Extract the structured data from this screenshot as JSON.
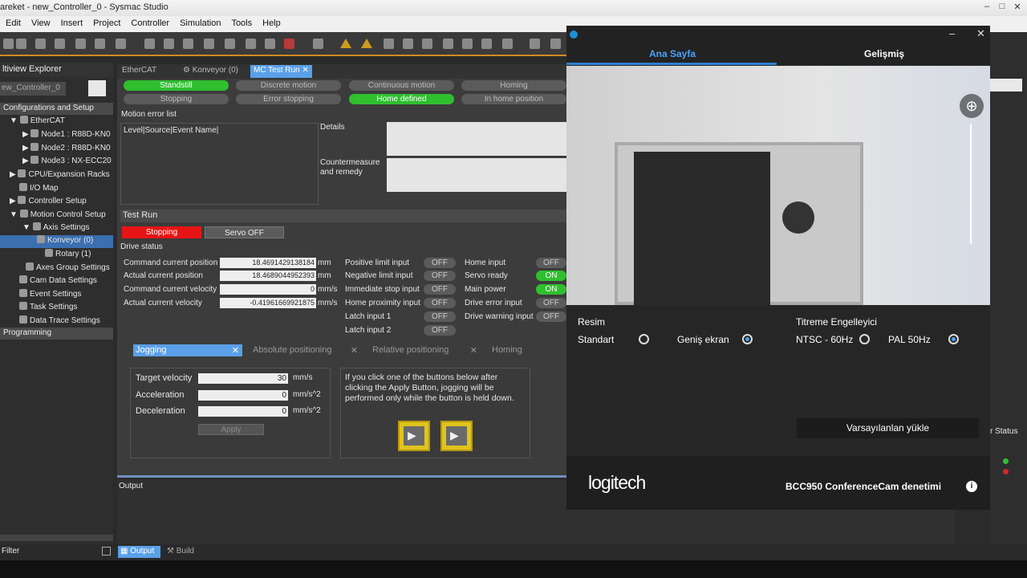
{
  "window": {
    "title": "areket - new_Controller_0 - Sysmac Studio"
  },
  "menu": [
    "Edit",
    "View",
    "Insert",
    "Project",
    "Controller",
    "Simulation",
    "Tools",
    "Help"
  ],
  "explorer": {
    "header": "ltiview Explorer",
    "controller": "ew_Controller_0",
    "section_config": "Configurations and Setup",
    "items": [
      {
        "label": "EtherCAT",
        "icon": "ethercat-icon"
      },
      {
        "label": "Node1 : R88D-KN0",
        "icon": "node-icon"
      },
      {
        "label": "Node2 : R88D-KN0",
        "icon": "node-icon"
      },
      {
        "label": "Node3 : NX-ECC20",
        "icon": "node-icon"
      },
      {
        "label": "CPU/Expansion Racks",
        "icon": "rack-icon"
      },
      {
        "label": "I/O Map",
        "icon": "io-map-icon"
      },
      {
        "label": "Controller Setup",
        "icon": "controller-setup-icon"
      },
      {
        "label": "Motion Control Setup",
        "icon": "motion-icon"
      },
      {
        "label": "Axis Settings",
        "icon": "axis-icon"
      },
      {
        "label": "Konveyor (0)",
        "icon": "axis-icon"
      },
      {
        "label": "Rotary (1)",
        "icon": "axis-icon"
      },
      {
        "label": "Axes Group Settings",
        "icon": "axes-group-icon"
      },
      {
        "label": "Cam Data Settings",
        "icon": "cam-icon"
      },
      {
        "label": "Event Settings",
        "icon": "event-icon"
      },
      {
        "label": "Task Settings",
        "icon": "task-icon"
      },
      {
        "label": "Data Trace Settings",
        "icon": "trace-icon"
      }
    ],
    "section_programming": "Programming",
    "filter": "Filter"
  },
  "editor": {
    "tabs": [
      "EtherCAT",
      "Konveyor (0)",
      "MC Test Run"
    ],
    "status_row1": [
      "Standstill",
      "Discrete motion",
      "Continuous motion",
      "Homing"
    ],
    "status_row2": [
      "Stopping",
      "Error stopping",
      "Home defined",
      "In home position"
    ],
    "motion_error_list": "Motion error list",
    "error_list_header": "Level|Source|Event Name|",
    "details_label": "Details",
    "countermeasure_label": "Countermeasure and remedy",
    "test_run_label": "Test Run",
    "stopping_btn": "Stopping",
    "servo_off_btn": "Servo OFF",
    "drive_status": "Drive status",
    "drive_rows": [
      {
        "label": "Command current position",
        "value": "18.4691429138184",
        "unit": "mm"
      },
      {
        "label": "Actual current position",
        "value": "18.4689044952393",
        "unit": "mm"
      },
      {
        "label": "Command current velocity",
        "value": "0",
        "unit": "mm/s"
      },
      {
        "label": "Actual current velocity",
        "value": "-0.41961669921875",
        "unit": "mm/s"
      }
    ],
    "inputs_mid": [
      {
        "label": "Positive limit input",
        "state": "OFF"
      },
      {
        "label": "Negative limit input",
        "state": "OFF"
      },
      {
        "label": "Immediate stop input",
        "state": "OFF"
      },
      {
        "label": "Home proximity input",
        "state": "OFF"
      },
      {
        "label": "Latch input 1",
        "state": "OFF"
      },
      {
        "label": "Latch input 2",
        "state": "OFF"
      }
    ],
    "inputs_right": [
      {
        "label": "Home input",
        "state": "OFF"
      },
      {
        "label": "Servo ready",
        "state": "ON"
      },
      {
        "label": "Main power",
        "state": "ON"
      },
      {
        "label": "Drive error input",
        "state": "OFF"
      },
      {
        "label": "Drive warning input",
        "state": "OFF"
      }
    ],
    "sub_tabs": [
      "Jogging",
      "Absolute positioning",
      "Relative positioning",
      "Homing"
    ],
    "jog": {
      "target_velocity": {
        "label": "Target velocity",
        "value": "30",
        "unit": "mm/s"
      },
      "acceleration": {
        "label": "Acceleration",
        "value": "0",
        "unit": "mm/s^2"
      },
      "deceleration": {
        "label": "Deceleration",
        "value": "0",
        "unit": "mm/s^2"
      },
      "apply": "Apply",
      "help": "If you click one of the buttons below after clicking the Apply Button, jogging will be performed only while the button is held down."
    },
    "output_label": "Output"
  },
  "bottom_tabs": [
    "Output",
    "Build"
  ],
  "camera": {
    "tabs": [
      "Ana Sayfa",
      "Gelişmiş"
    ],
    "resim_label": "Resim",
    "standart": "Standart",
    "genis": "Geniş ekran",
    "titreme_label": "Titreme Engelleyici",
    "ntsc": "NTSC - 60Hz",
    "pal": "PAL 50Hz",
    "defaults_btn": "Varsayılanlan yükle",
    "brand": "logitech",
    "product": "BCC950 ConferenceCam denetimi"
  },
  "right_strip": {
    "status": "r Status"
  }
}
